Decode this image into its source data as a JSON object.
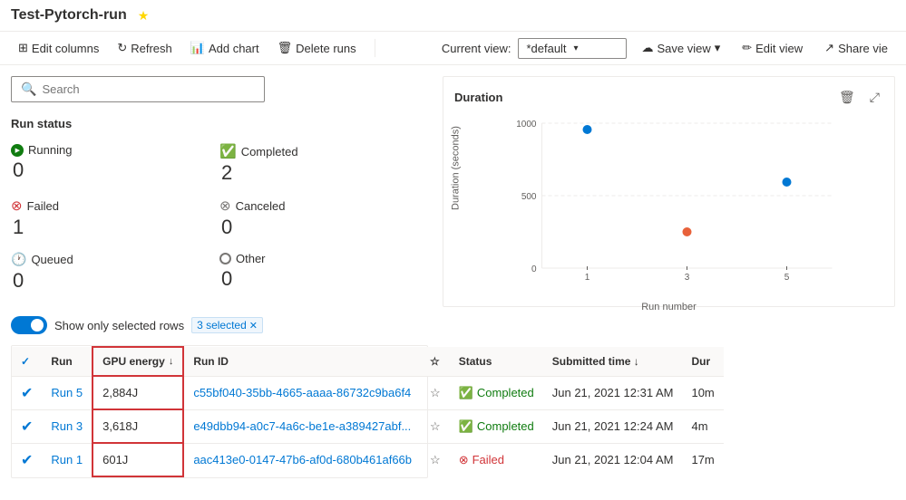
{
  "page": {
    "title": "Test-Pytorch-run"
  },
  "toolbar": {
    "edit_columns": "Edit columns",
    "refresh": "Refresh",
    "add_chart": "Add chart",
    "delete_runs": "Delete runs",
    "current_view_label": "Current view:",
    "view_value": "*default",
    "save_view": "Save view",
    "edit_view": "Edit view",
    "share_view": "Share vie"
  },
  "search": {
    "placeholder": "Search"
  },
  "run_status": {
    "title": "Run status",
    "running_label": "Running",
    "running_count": "0",
    "completed_label": "Completed",
    "completed_count": "2",
    "failed_label": "Failed",
    "failed_count": "1",
    "canceled_label": "Canceled",
    "canceled_count": "0",
    "queued_label": "Queued",
    "queued_count": "0",
    "other_label": "Other",
    "other_count": "0"
  },
  "toggle": {
    "label": "Show only selected rows",
    "selected_text": "3 selected"
  },
  "table": {
    "headers": {
      "run": "Run",
      "gpu_energy": "GPU energy",
      "run_id": "Run ID",
      "status": "Status",
      "submitted_time": "Submitted time",
      "duration": "Dur"
    },
    "rows": [
      {
        "run": "Run 5",
        "gpu_energy": "2,884J",
        "run_id": "c55bf040-35bb-4665-aaaa-86732c9ba6f4",
        "status": "Completed",
        "submitted_time": "Jun 21, 2021 12:31 AM",
        "duration": "10m"
      },
      {
        "run": "Run 3",
        "gpu_energy": "3,618J",
        "run_id": "e49dbb94-a0c7-4a6c-be1e-a389427abf...",
        "status": "Completed",
        "submitted_time": "Jun 21, 2021 12:24 AM",
        "duration": "4m"
      },
      {
        "run": "Run 1",
        "gpu_energy": "601J",
        "run_id": "aac413e0-0147-47b6-af0d-680b461af66b",
        "status": "Failed",
        "submitted_time": "Jun 21, 2021 12:04 AM",
        "duration": "17m"
      }
    ]
  },
  "chart": {
    "title": "Duration",
    "y_label": "Duration (seconds)",
    "x_label": "Run number",
    "points": [
      {
        "x": 1,
        "y": 1050,
        "color": "#0078d4"
      },
      {
        "x": 3,
        "y": 275,
        "color": "#e8613a"
      },
      {
        "x": 5,
        "y": 650,
        "color": "#0078d4"
      }
    ],
    "y_ticks": [
      0,
      500,
      1000
    ],
    "x_ticks": [
      1,
      3,
      5
    ]
  }
}
